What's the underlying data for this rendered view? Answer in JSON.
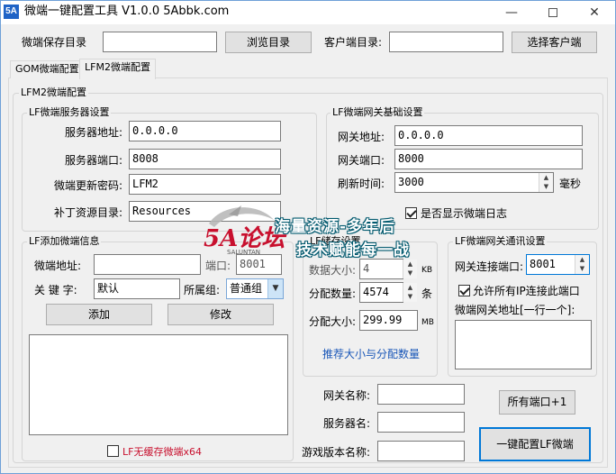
{
  "window": {
    "title": "微端一键配置工具 V1.0.0  5Abbk.com",
    "icon_text": "5A",
    "minimize_symbol": "—",
    "close_symbol": "✕"
  },
  "top": {
    "save_dir_label": "微端保存目录",
    "save_dir_value": "",
    "browse_button": "浏览目录",
    "client_dir_label": "客户端目录:",
    "client_dir_value": "",
    "select_client_button": "选择客户端"
  },
  "tabs": [
    {
      "label": "GOM微端配置",
      "active": false
    },
    {
      "label": "LFM2微端配置",
      "active": true
    }
  ],
  "lfm2": {
    "group_label": "LFM2微端配置",
    "server_settings": {
      "label": "LF微端服务器设置",
      "address_label": "服务器地址:",
      "address_value": "0.0.0.0",
      "port_label": "服务器端口:",
      "port_value": "8008",
      "update_pwd_label": "微端更新密码:",
      "update_pwd_value": "LFM2",
      "patch_dir_label": "补丁资源目录:",
      "patch_dir_value": "Resources"
    },
    "gateway_settings": {
      "label": "LF微端网关基础设置",
      "gateway_addr_label": "网关地址:",
      "gateway_addr_value": "0.0.0.0",
      "gateway_port_label": "网关端口:",
      "gateway_port_value": "8000",
      "refresh_label": "刷新时间:",
      "refresh_value": "3000",
      "refresh_unit": "毫秒",
      "show_log_label": "是否显示微端日志",
      "show_log_checked": true
    },
    "add_info": {
      "label": "LF添加微端信息",
      "addr_label": "微端地址:",
      "addr_value": "",
      "port_label": "端口:",
      "port_value": "8001",
      "keyword_label": "关 键 字:",
      "keyword_value": "默认",
      "group_label": "所属组:",
      "group_value": "普通组",
      "add_button": "添加",
      "modify_button": "修改",
      "no_cache_label": "LF无缓存微端x64",
      "no_cache_checked": false
    },
    "storage": {
      "label": "LF储存设置",
      "block_size_label": "数据大小:",
      "block_size_value": "4",
      "block_size_unit": "KB",
      "alloc_count_label": "分配数量:",
      "alloc_count_value": "4574",
      "alloc_count_unit": "条",
      "alloc_size_label": "分配大小:",
      "alloc_size_value": "299.99",
      "alloc_size_unit": "MB",
      "recommend_link": "推荐大小与分配数量"
    },
    "gateway_comm": {
      "label": "LF微端网关通讯设置",
      "conn_port_label": "网关连接端口:",
      "conn_port_value": "8001",
      "allow_all_label": "允许所有IP连接此端口",
      "allow_all_checked": true,
      "addr_list_label": "微端网关地址[一行一个]:"
    },
    "bottom": {
      "gateway_name_label": "网关名称:",
      "gateway_name_value": "",
      "server_name_label": "服务器名:",
      "server_name_value": "",
      "game_version_label": "游戏版本名称:",
      "game_version_value": "",
      "all_ports_button": "所有端口+1",
      "one_key_button": "一键配置LF微端"
    }
  },
  "watermark": {
    "logo_text": "5A论坛",
    "logo_sub": "SALUNTAN",
    "line1": "海量资源-多年后",
    "line2": "技术赋能每一战"
  },
  "colors": {
    "titlebar_bg": "#ffffff",
    "window_bg": "#f0f0f0",
    "icon_blue": "#1f63c6",
    "focus_blue": "#0078d7",
    "link_blue": "#1a57b8",
    "red_label": "#c8102e",
    "watermark_red": "#c8102e"
  }
}
